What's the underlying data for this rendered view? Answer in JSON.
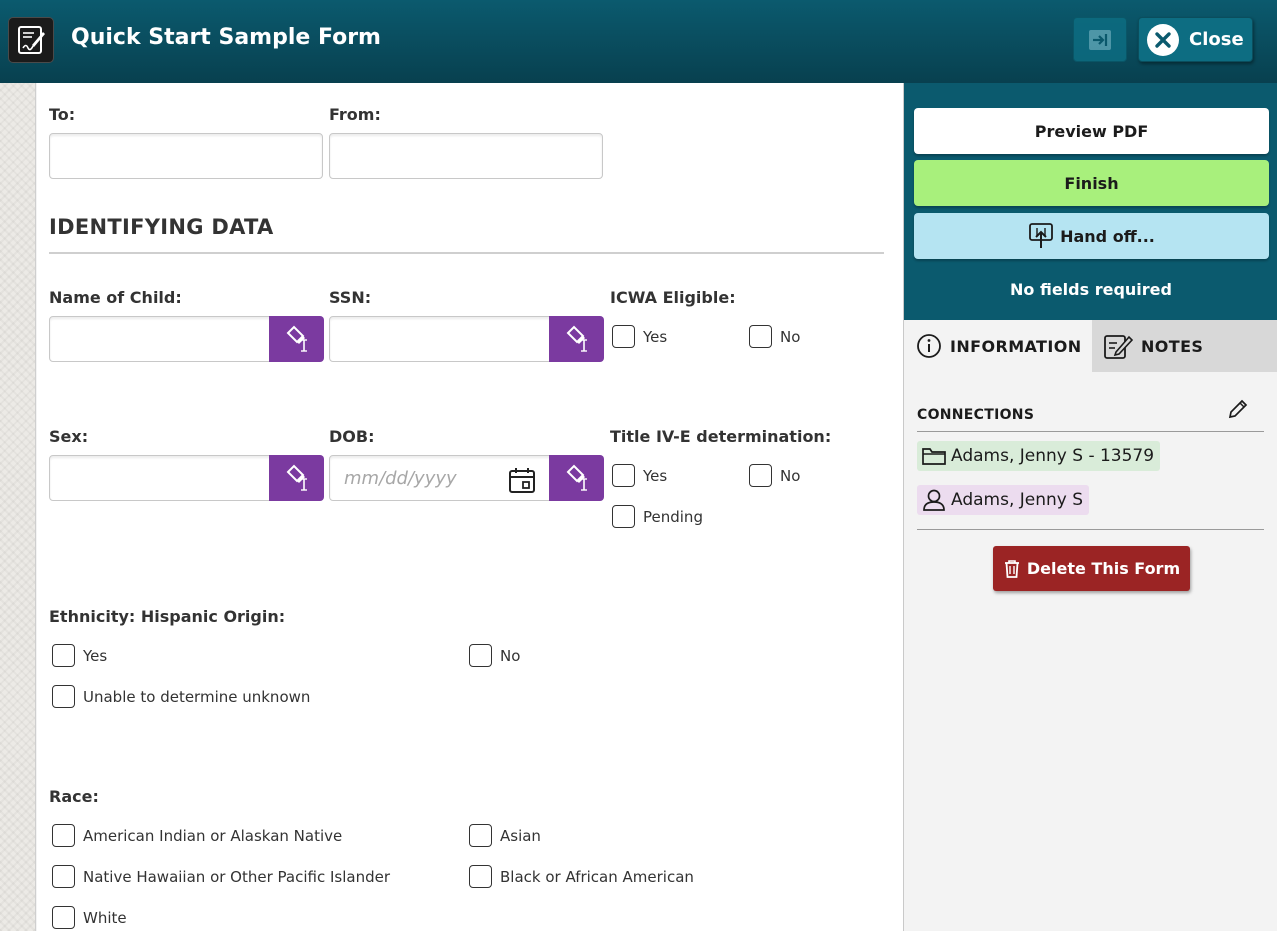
{
  "header": {
    "title": "Quick Start Sample Form",
    "close_label": "Close"
  },
  "form": {
    "to_label": "To:",
    "from_label": "From:",
    "section_title": "IDENTIFYING DATA",
    "name_label": "Name of Child:",
    "ssn_label": "SSN:",
    "icwa_label": "ICWA Eligible:",
    "icwa_options": [
      "Yes",
      "No"
    ],
    "sex_label": "Sex:",
    "dob_label": "DOB:",
    "dob_placeholder": "mm/dd/yyyy",
    "title_ive_label": "Title IV-E determination:",
    "title_ive_options": [
      "Yes",
      "No",
      "Pending"
    ],
    "ethnicity_label": "Ethnicity: Hispanic Origin:",
    "ethnicity_options": [
      "Yes",
      "No",
      "Unable to determine unknown"
    ],
    "race_label": "Race:",
    "race_options": [
      "American Indian or Alaskan Native",
      "Asian",
      "Native Hawaiian or Other Pacific Islander",
      "Black or African American",
      "White"
    ]
  },
  "sidebar": {
    "preview_label": "Preview PDF",
    "finish_label": "Finish",
    "handoff_label": "Hand off...",
    "status_text": "No fields required",
    "tabs": [
      "INFORMATION",
      "NOTES"
    ],
    "connections_title": "CONNECTIONS",
    "connections": [
      "Adams, Jenny S - 13579",
      "Adams, Jenny S"
    ],
    "delete_label": "Delete This Form"
  },
  "colors": {
    "header": "#0b5a6e",
    "accent_purple": "#7b3aa0",
    "finish_green": "#a8f07c",
    "handoff_blue": "#b5e4f2",
    "delete_red": "#9b2424",
    "case_chip": "#d9ecd9",
    "person_chip": "#ecdcef"
  }
}
